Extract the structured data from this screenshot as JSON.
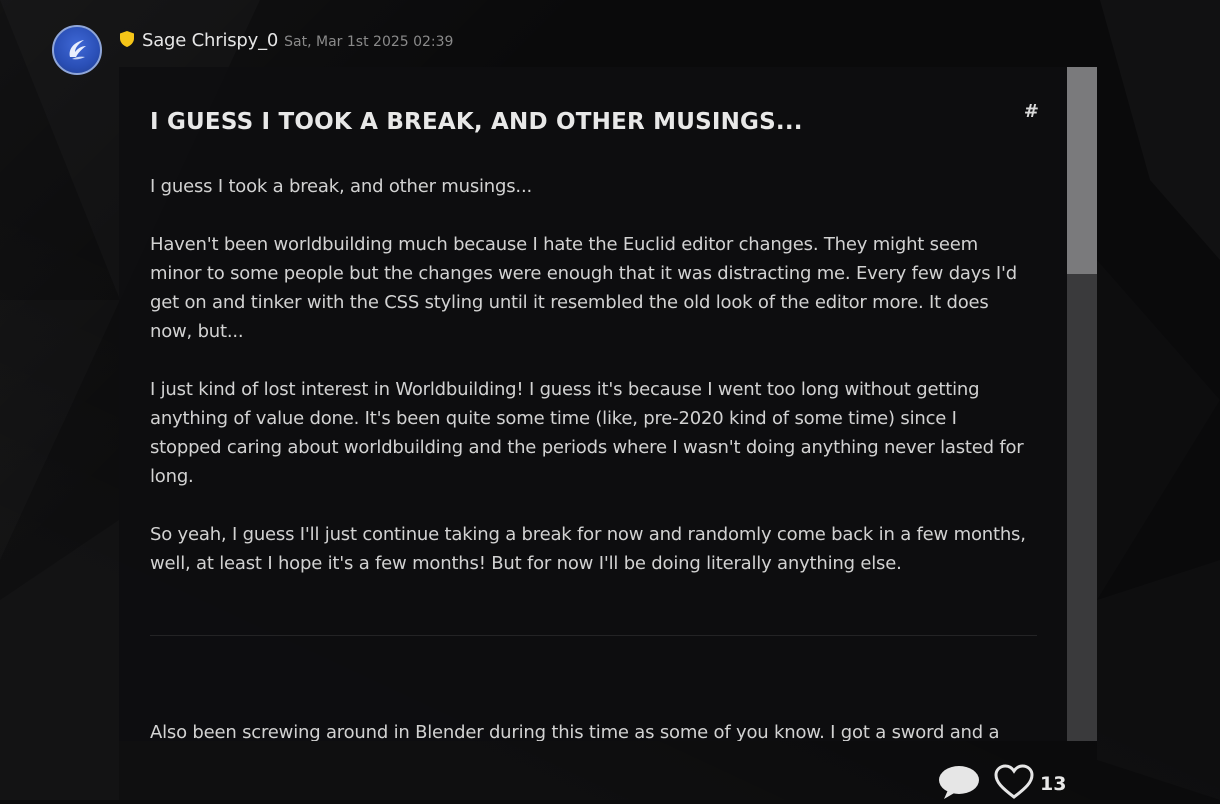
{
  "post": {
    "author": "Sage Chrispy_0",
    "date": "Sat, Mar 1st 2025 02:39",
    "anchor": "#",
    "title": "I GUESS I TOOK A BREAK, AND OTHER MUSINGS...",
    "paragraphs": [
      "I guess I took a break, and other musings...",
      "Haven't been worldbuilding much because I hate the Euclid editor changes. They might seem minor to some people but the changes were enough that it was distracting me. Every few days I'd get on and tinker with the CSS styling until it resembled the old look of the editor more. It does now, but...",
      "I just kind of lost interest in Worldbuilding! I guess it's because I went too long without getting anything of value done. It's been quite some time (like, pre-2020 kind of some time) since I stopped caring about worldbuilding and the periods where I wasn't doing anything never lasted for long.",
      "So yeah, I guess I'll just continue taking a break for now and randomly come back in a few months, well, at least I hope it's a few months! But for now I'll be doing literally anything else."
    ],
    "after_divider": "Also been screwing around in Blender during this time as some of you know. I got a sword and a",
    "like_count": "13"
  },
  "icons": {
    "avatar": "wing-emblem-icon",
    "badge": "shield-icon",
    "comment": "comment-icon",
    "like": "heart-icon"
  },
  "colors": {
    "badge": "#f5c518",
    "avatar": "#2a4fb6",
    "scroll_thumb": "#7a7a7c",
    "scroll_track": "#3a3a3c"
  }
}
